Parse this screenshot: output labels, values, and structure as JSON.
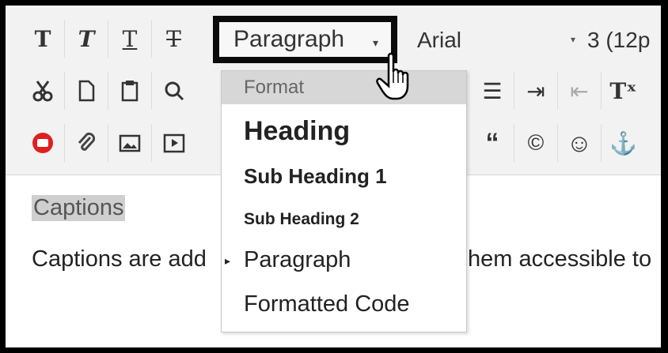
{
  "toolbar": {
    "row1": [
      {
        "name": "bold-button",
        "glyph": "T"
      },
      {
        "name": "italic-button",
        "glyph": "T"
      },
      {
        "name": "underline-button",
        "glyph": "T"
      },
      {
        "name": "strikethrough-button",
        "glyph": "T"
      }
    ],
    "format_select": {
      "value": "Paragraph",
      "arrow": "▾"
    },
    "font_select": {
      "value": "Arial",
      "arrow": "▾"
    },
    "size_select": {
      "value": "3 (12p"
    },
    "row2_icons": [
      "cut-icon",
      "copy-icon",
      "paste-icon",
      "find-icon"
    ],
    "row3_icons": [
      "youtube-icon",
      "attach-icon",
      "image-icon",
      "media-icon"
    ],
    "row2_right": [
      {
        "name": "align-icon",
        "glyph": "☰"
      },
      {
        "name": "indent-icon",
        "glyph": "⇥"
      },
      {
        "name": "outdent-icon",
        "glyph": "⇤"
      },
      {
        "name": "superscript-icon",
        "glyph": "Tˣ"
      }
    ],
    "row3_right": [
      {
        "name": "quote-icon",
        "glyph": "“"
      },
      {
        "name": "copyright-icon",
        "glyph": "©"
      },
      {
        "name": "emoji-icon",
        "glyph": "☺"
      },
      {
        "name": "anchor-icon",
        "glyph": "⚓"
      }
    ]
  },
  "dropdown": {
    "header": "Format",
    "items": [
      "Heading",
      "Sub Heading 1",
      "Sub Heading 2",
      "Paragraph",
      "Formatted Code"
    ],
    "selected_marker": "▸"
  },
  "content": {
    "heading": "Captions",
    "paragraph": "Captions are add",
    "paragraph_tail": "hem accessible to"
  }
}
